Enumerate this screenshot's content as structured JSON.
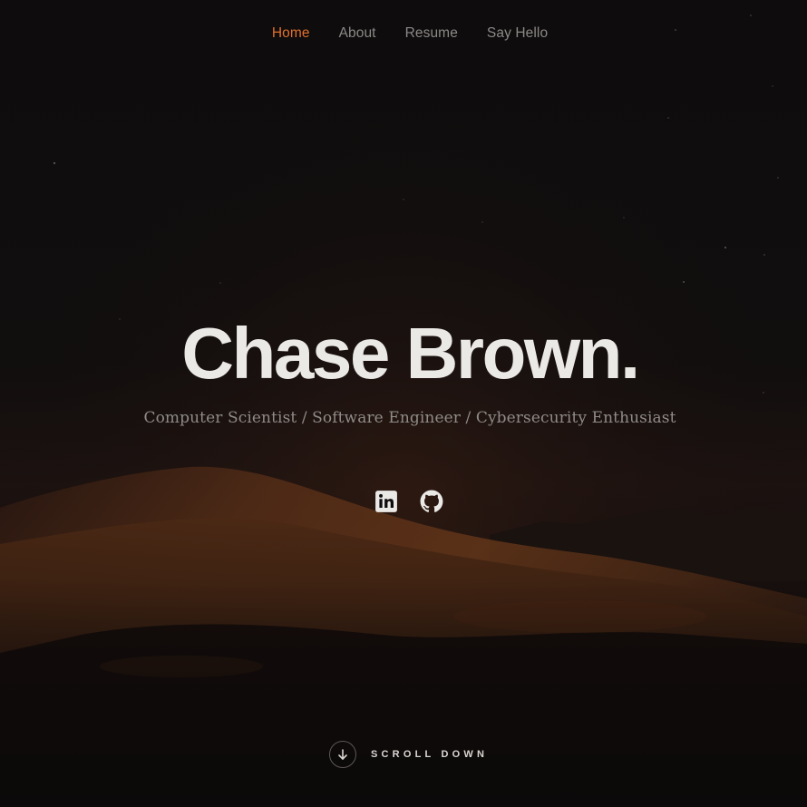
{
  "nav": {
    "items": [
      {
        "label": "Home",
        "active": true
      },
      {
        "label": "About",
        "active": false
      },
      {
        "label": "Resume",
        "active": false
      },
      {
        "label": "Say Hello",
        "active": false
      }
    ]
  },
  "hero": {
    "title": "Chase Brown.",
    "subtitle": "Computer Scientist / Software Engineer / Cybersecurity Enthusiast"
  },
  "social": [
    {
      "icon": "linkedin-icon"
    },
    {
      "icon": "github-icon"
    }
  ],
  "scroll": {
    "label": "SCROLL DOWN",
    "icon": "arrow-down-icon"
  },
  "colors": {
    "accent": "#e0702c",
    "title": "#ebe9e6",
    "nav": "#8c8886",
    "background": "#0e0c0d"
  }
}
